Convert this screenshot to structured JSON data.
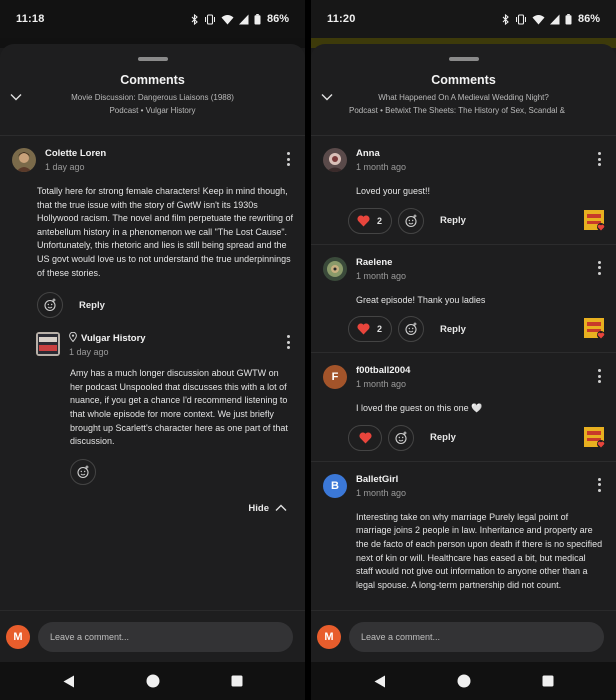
{
  "left": {
    "status": {
      "time": "11:18",
      "battery": "86%"
    },
    "sheet": {
      "title": "Comments",
      "subtitle_line1": "Movie Discussion: Dangerous Liaisons (1988)",
      "subtitle_line2": "Podcast • Vulgar History"
    },
    "comment": {
      "author": "Colette Loren",
      "time": "1 day ago",
      "text": "Totally here for strong female characters! Keep in mind though, that the true issue with the story of GwtW isn't its 1930s Hollywood racism. The novel and film perpetuate the rewriting of antebellum history in a phenomenon we call \"The Lost Cause\". Unfortunately, this rhetoric and lies is still being spread and the US govt would love us to not understand the true underpinnings of these stories.",
      "reply_label": "Reply"
    },
    "reply": {
      "author": "Vulgar History",
      "time": "1 day ago",
      "text": "Amy has a much longer discussion about GWTW on her podcast Unspooled that discusses this with a lot of nuance, if you get a chance I'd recommend listening to that whole episode for more context. We just briefly brought up Scarlett's character here as one part of that discussion.",
      "avatar_text": "REVEL GRIGHT"
    },
    "hide_label": "Hide",
    "input": {
      "placeholder": "Leave a comment...",
      "avatar_letter": "M"
    }
  },
  "right": {
    "status": {
      "time": "11:20",
      "battery": "86%"
    },
    "sheet": {
      "title": "Comments",
      "subtitle_line1": "What Happened On A Medieval Wedding Night?",
      "subtitle_line2": "Podcast • Betwixt The Sheets: The History of Sex, Scandal &"
    },
    "comments": [
      {
        "author": "Anna",
        "time": "1 month ago",
        "text": "Loved your guest!!",
        "hearts": "2",
        "reply_label": "Reply"
      },
      {
        "author": "Raelene",
        "time": "1 month ago",
        "text": "Great episode! Thank you ladies",
        "hearts": "2",
        "reply_label": "Reply"
      },
      {
        "author": "f00tball2004",
        "time": "1 month ago",
        "text": "I loved the guest on this one 🤍",
        "avatar_letter": "F",
        "reply_label": "Reply"
      },
      {
        "author": "BalletGirl",
        "time": "1 month ago",
        "text": "Interesting take on why marriage Purely legal point of marriage joins 2 people in law. Inheritance and property are the de facto of each person upon death if there is no specified next of kin or will. Healthcare has eased a bit, but medical staff would not give out information to anyone other than a legal spouse. A long-term partnership did not count.",
        "avatar_letter": "B"
      }
    ],
    "input": {
      "placeholder": "Leave a comment...",
      "avatar_letter": "M"
    }
  },
  "colors": {
    "heart": "#e8453c",
    "accent_orange": "#e85d2c",
    "f_avatar": "#a3542a",
    "b_avatar": "#3b78d8"
  }
}
